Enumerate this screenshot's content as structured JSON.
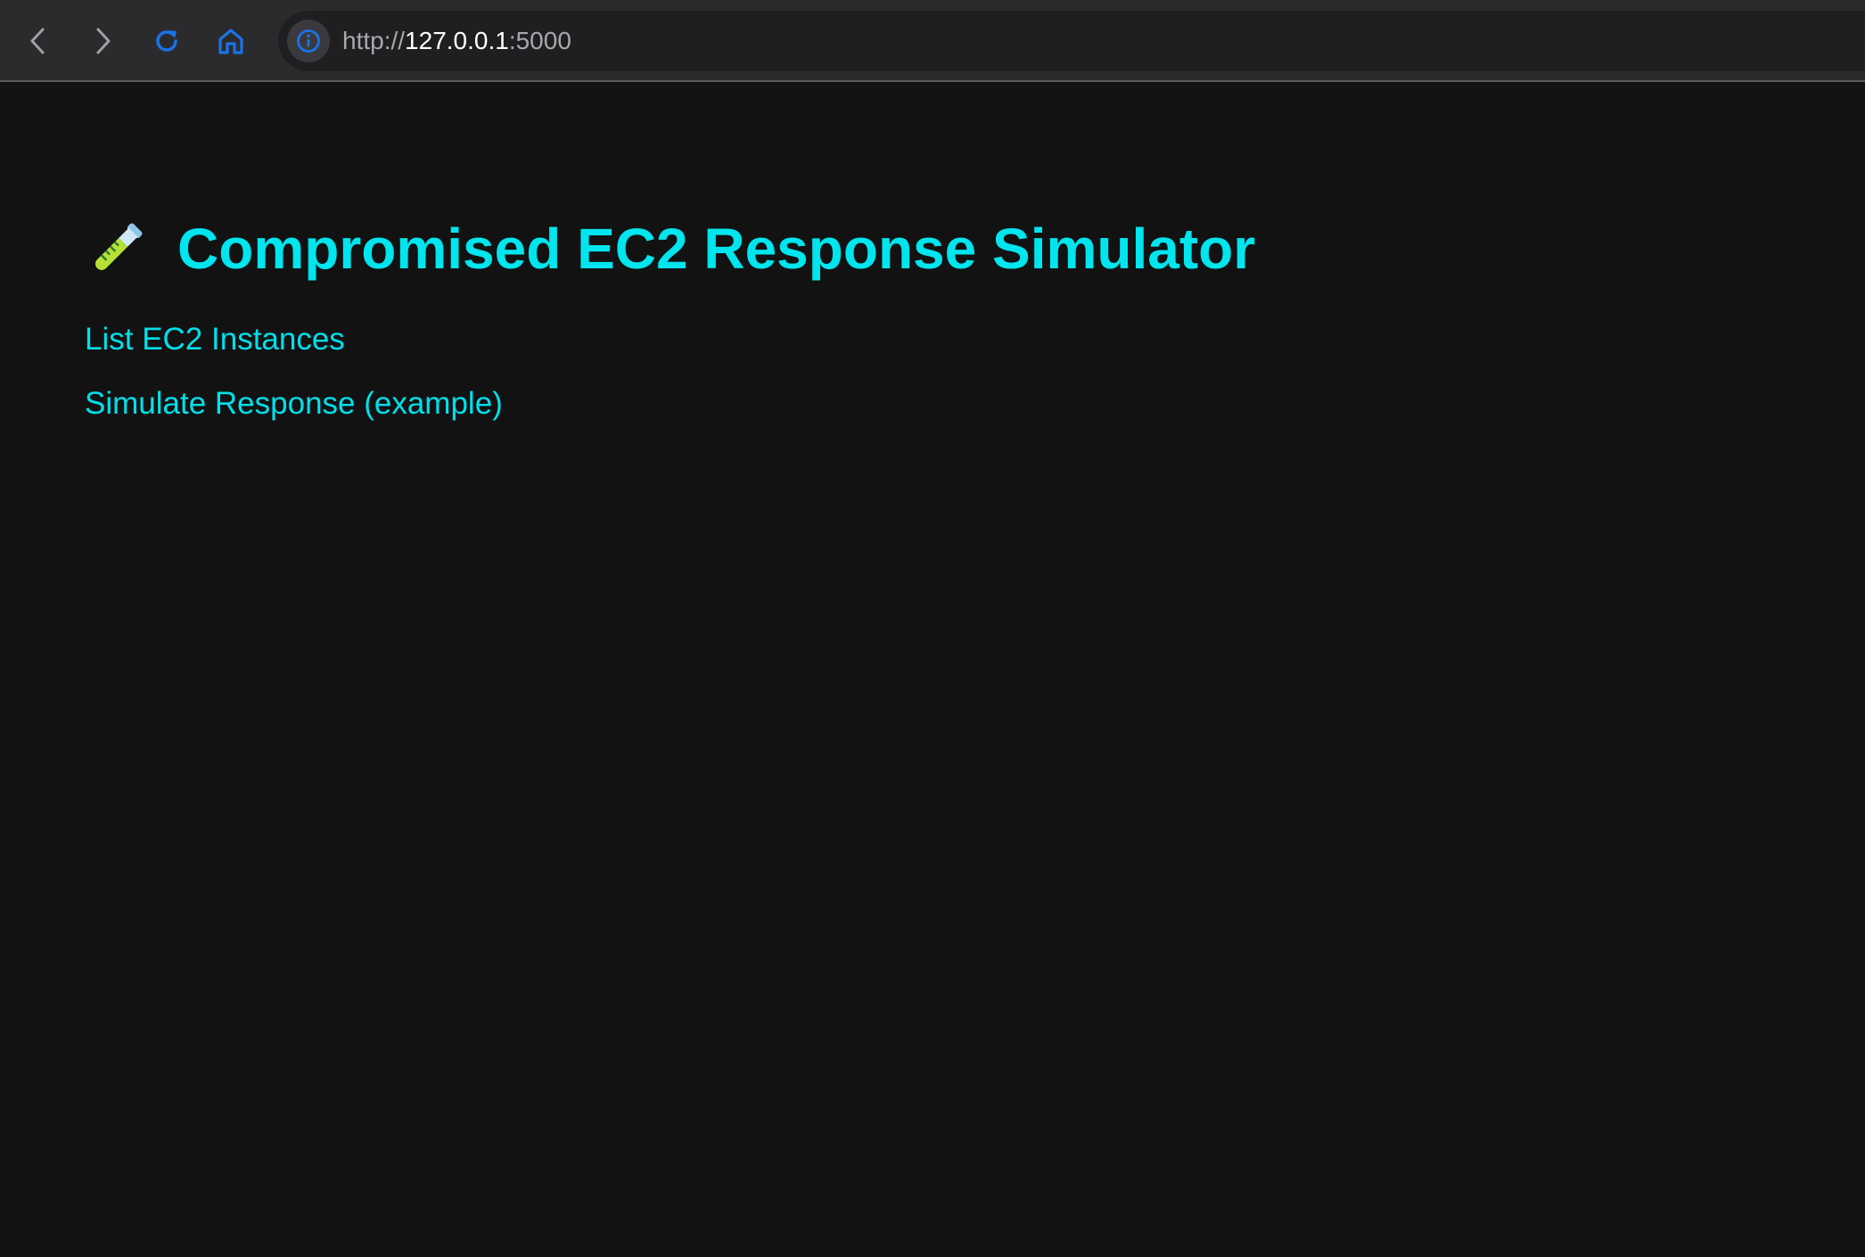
{
  "browser": {
    "url_scheme": "http://",
    "url_host": "127.0.0.1",
    "url_port": ":5000",
    "icon_color": "#1a73e8"
  },
  "page": {
    "title_icon": "test-tube-emoji",
    "title": "Compromised EC2 Response Simulator",
    "links": [
      {
        "label": "List EC2 Instances"
      },
      {
        "label": "Simulate Response (example)"
      }
    ],
    "accent_color": "#00e5ee",
    "background_color": "#121212"
  }
}
